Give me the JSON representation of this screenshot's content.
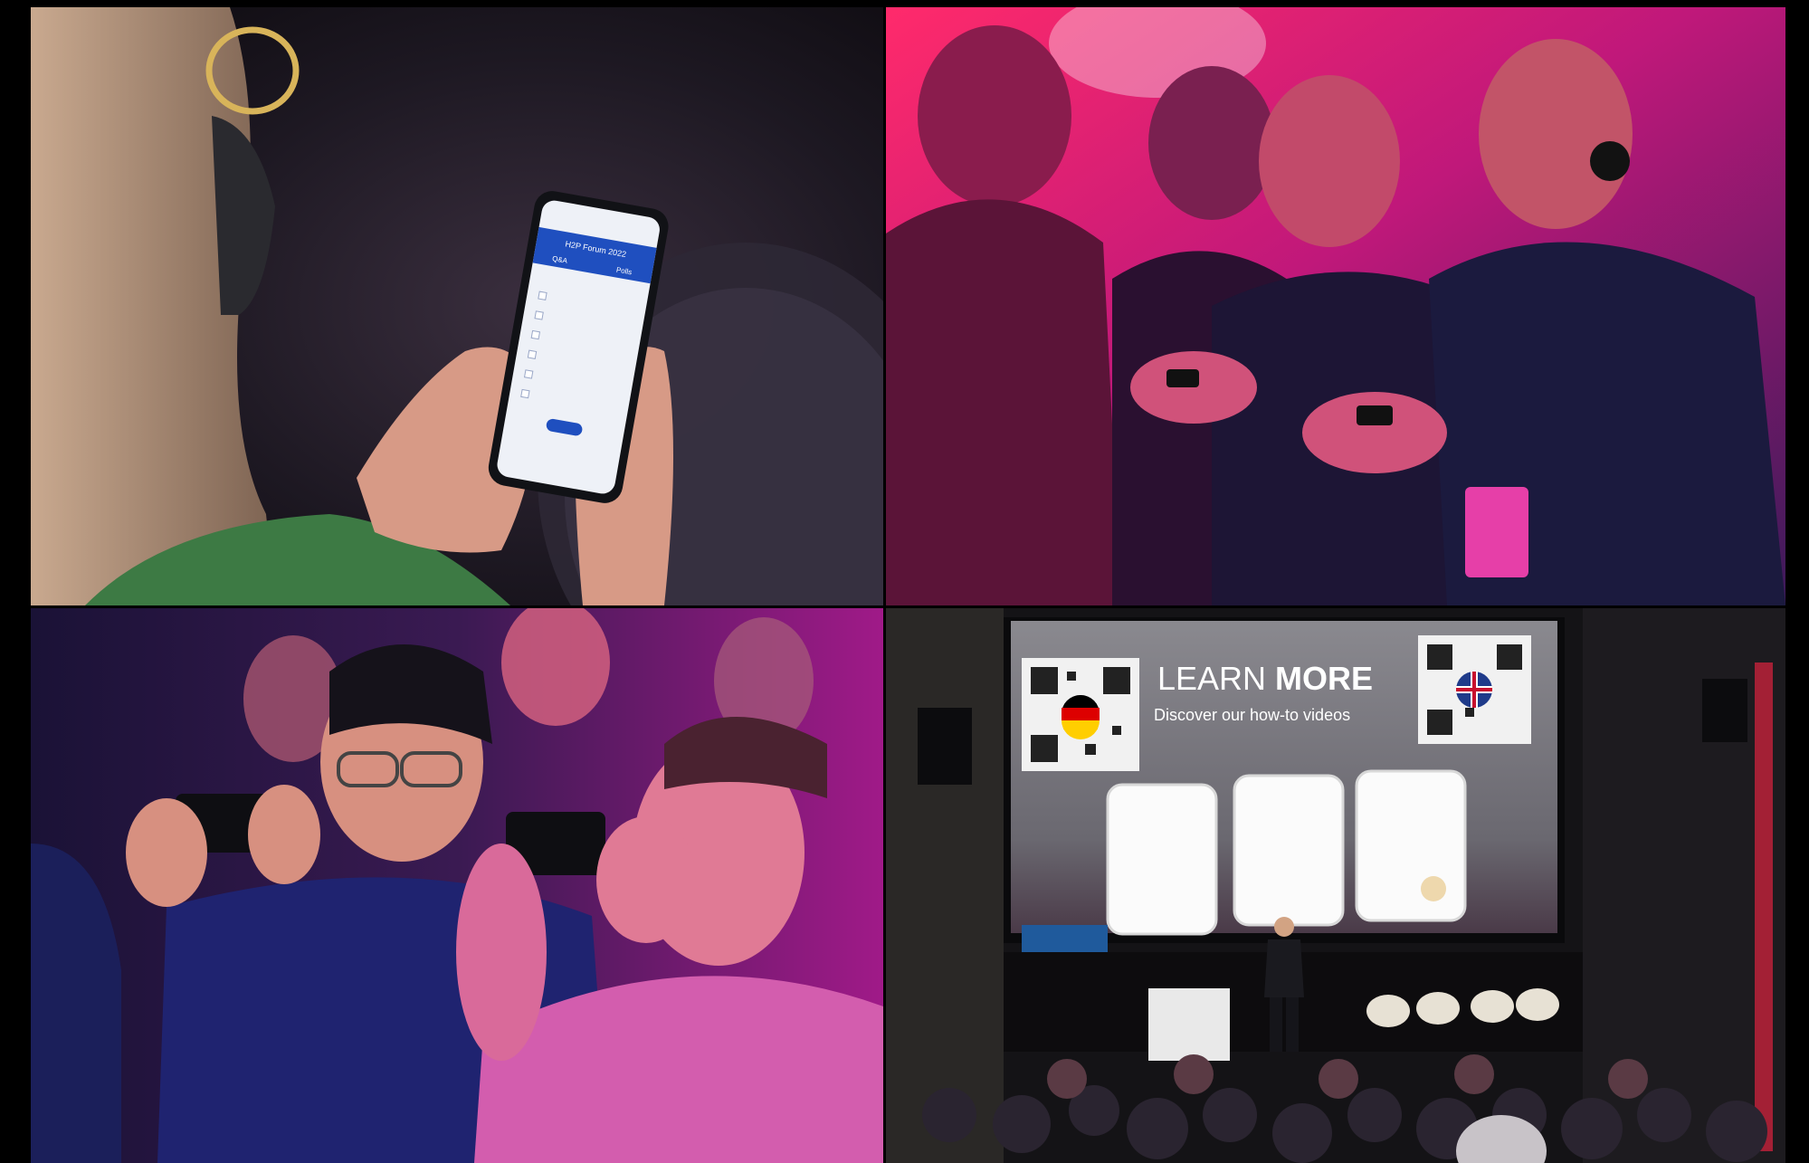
{
  "collage": {
    "panels": [
      {
        "name": "phone-user-panel"
      },
      {
        "name": "audience-phones-panel"
      },
      {
        "name": "photographers-panel"
      },
      {
        "name": "stage-presentation-panel"
      }
    ]
  },
  "phone_screen": {
    "header_title": "H2P Forum 2022",
    "tab_qa": "Q&A",
    "tab_polls": "Polls"
  },
  "stage_screen": {
    "headline_light": "LEARN ",
    "headline_bold": "MORE",
    "subtitle": "Discover our how-to videos"
  },
  "colors": {
    "magenta": "#e0239b",
    "purple": "#5a1a8f",
    "navy": "#171a45",
    "phone_blue": "#1f4fbf",
    "screen_gray": "#7b7a80"
  },
  "icons": {
    "german_flag": "flag-germany-icon",
    "uk_flag": "flag-uk-icon",
    "qr_code": "qr-code-icon"
  }
}
